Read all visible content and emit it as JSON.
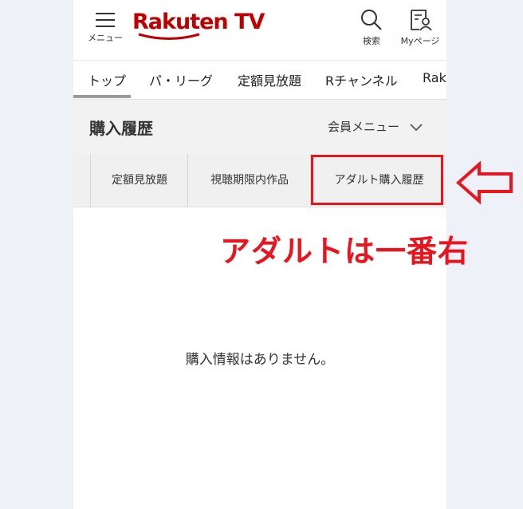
{
  "header": {
    "menu_label": "メニュー",
    "logo_text": "Rakuten TV",
    "search_label": "検索",
    "mypage_label": "Myページ"
  },
  "nav": {
    "items": [
      "トップ",
      "パ・リーグ",
      "定額見放題",
      "Rチャンネル",
      "Raku"
    ]
  },
  "title_bar": {
    "title": "購入履歴",
    "member_menu": "会員メニュー"
  },
  "tabs": [
    "定額見放題",
    "視聴期限内作品",
    "アダルト購入履歴"
  ],
  "empty_message": "購入情報はありません。",
  "annotation": {
    "text": "アダルトは一番右",
    "color": "#e8141e"
  },
  "brand_color": "#bf0000"
}
